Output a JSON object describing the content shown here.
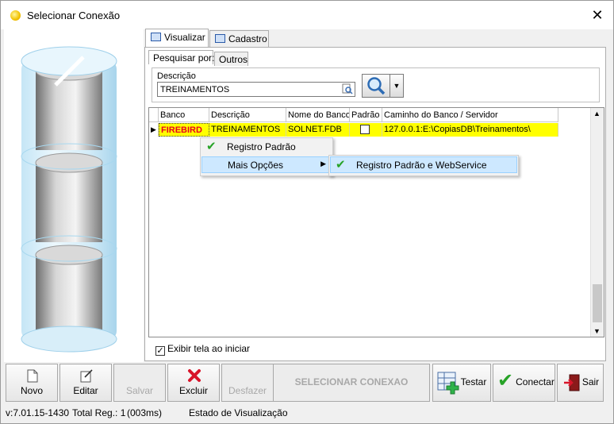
{
  "window": {
    "title": "Selecionar Conexão",
    "close_glyph": "✕"
  },
  "tabs": [
    {
      "label": "Visualizar",
      "icon": "window-icon"
    },
    {
      "label": "Cadastro",
      "icon": "window-icon"
    }
  ],
  "subtabs": [
    {
      "label": "Pesquisar por:"
    },
    {
      "label": "Outros"
    }
  ],
  "search": {
    "label": "Descrição",
    "value": "TREINAMENTOS"
  },
  "grid": {
    "columns": [
      "Banco",
      "Descrição",
      "Nome do Banco",
      "Padrão",
      "Caminho do Banco / Servidor"
    ],
    "rows": [
      {
        "banco": "FIREBIRD",
        "descricao": "TREINAMENTOS",
        "nome": "SOLNET.FDB",
        "padrao": false,
        "caminho": "127.0.0.1:E:\\CopiasDB\\Treinamentos\\"
      }
    ]
  },
  "context_menu": {
    "items": [
      {
        "label": "Registro Padrão"
      },
      {
        "label": "Mais Opções"
      }
    ],
    "submenu": [
      {
        "label": "Registro Padrão e WebService"
      }
    ]
  },
  "show_on_start": {
    "label": "Exibir tela ao iniciar",
    "checked": true
  },
  "toolbar": {
    "novo": "Novo",
    "editar": "Editar",
    "salvar": "Salvar",
    "excluir": "Excluir",
    "desfazer": "Desfazer",
    "selecionar": "SELECIONAR CONEXAO",
    "testar": "Testar",
    "conectar": "Conectar",
    "sair": "Sair"
  },
  "status": {
    "version": "v:7.01.15-1430",
    "total": "Total Reg.: 1",
    "time": "(003ms)",
    "state": "Estado de Visualização"
  },
  "colors": {
    "row_highlight": "#ffff00",
    "banco_text": "#e8001c",
    "menu_highlight": "#cde8ff"
  }
}
